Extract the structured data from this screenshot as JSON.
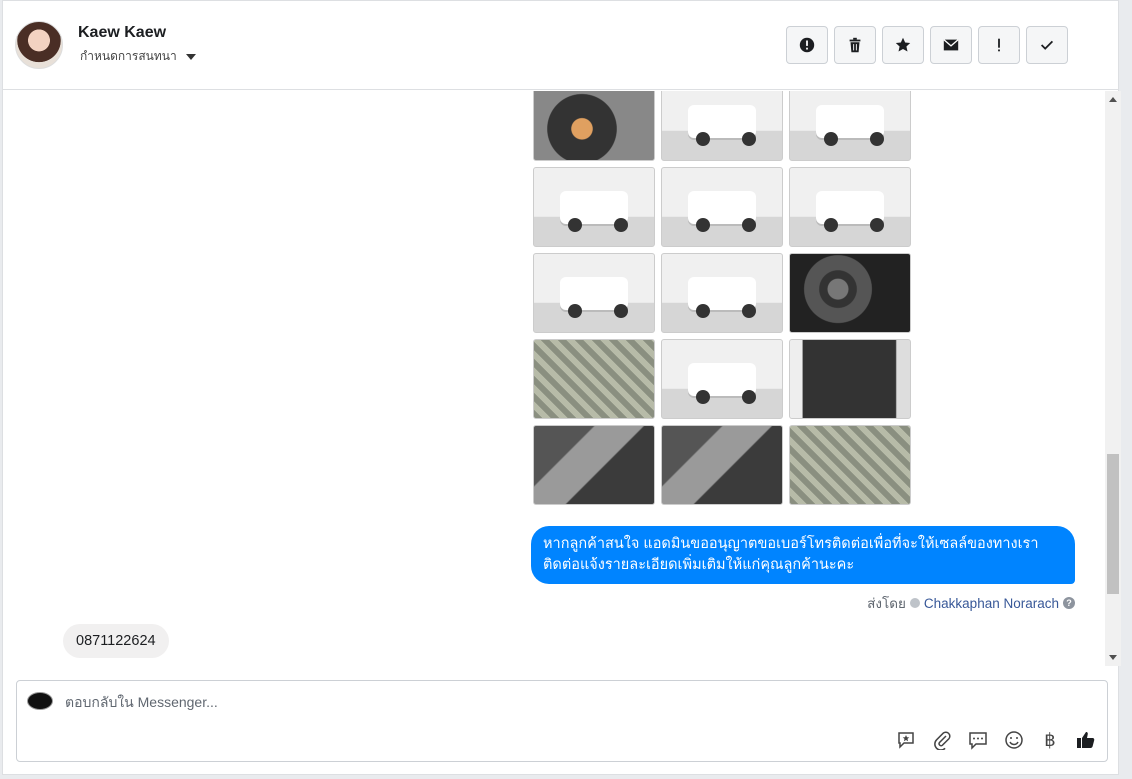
{
  "header": {
    "name": "Kaew Kaew",
    "assign_label": "กำหนดการสนทนา",
    "actions": [
      {
        "icon": "alert-circle-icon",
        "glyph": "!"
      },
      {
        "icon": "trash-icon"
      },
      {
        "icon": "star-icon"
      },
      {
        "icon": "envelope-icon"
      },
      {
        "icon": "exclamation-icon",
        "glyph": "!"
      },
      {
        "icon": "checkmark-icon"
      }
    ]
  },
  "thread": {
    "outgoing_message": "หากลูกค้าสนใจ แอดมินขออนุญาตขอเบอร์โทรติดต่อเพื่อที่จะให้เซลล์ของทางเราติดต่อแจ้งรายละเอียดเพิ่มเติมให้แก่คุณลูกค้านะคะ",
    "sent_by_label": "ส่งโดย",
    "sent_by_name": "Chakkaphan Norarach",
    "incoming_message": "0871122624",
    "photos": [
      {
        "scene": "engine"
      },
      {
        "scene": "truck-front"
      },
      {
        "scene": "truck-rear"
      },
      {
        "scene": "truck-rear"
      },
      {
        "scene": "truck-front"
      },
      {
        "scene": "truck-front"
      },
      {
        "scene": "truck-rear"
      },
      {
        "scene": "truck-side"
      },
      {
        "scene": "dashboard-gauges"
      },
      {
        "scene": "gear-shift"
      },
      {
        "scene": "truck-front"
      },
      {
        "scene": "door-panel"
      },
      {
        "scene": "dashboard"
      },
      {
        "scene": "steering-wheel"
      },
      {
        "scene": "seats"
      }
    ]
  },
  "composer": {
    "placeholder": "ตอบกลับใน Messenger...",
    "currency_symbol": "฿"
  },
  "colors": {
    "outgoing_bubble": "#0084ff",
    "incoming_bubble": "#f1f0f0",
    "link": "#385898"
  }
}
